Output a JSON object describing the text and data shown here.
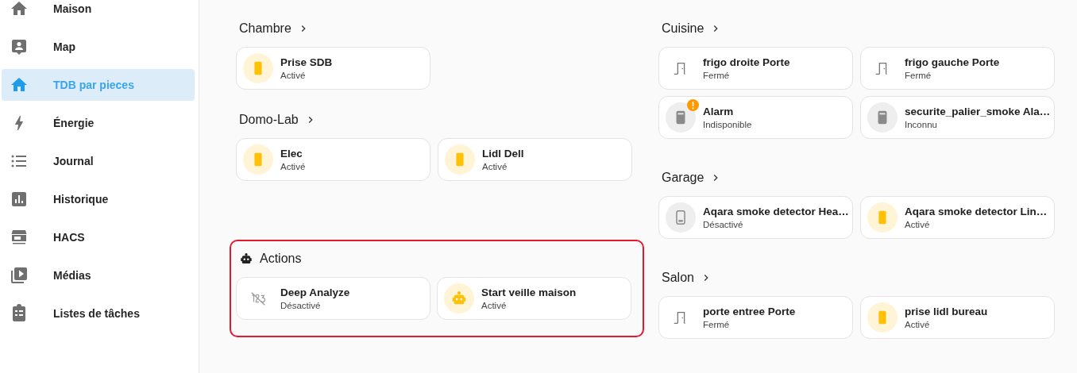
{
  "sidebar": {
    "items": [
      {
        "label": "Maison",
        "kind": "home",
        "selected": false
      },
      {
        "label": "Map",
        "kind": "map",
        "selected": false
      },
      {
        "label": "TDB par pieces",
        "kind": "home",
        "selected": true
      },
      {
        "label": "Énergie",
        "kind": "energy",
        "selected": false
      },
      {
        "label": "Journal",
        "kind": "logbook",
        "selected": false
      },
      {
        "label": "Historique",
        "kind": "history",
        "selected": false
      },
      {
        "label": "HACS",
        "kind": "hacs",
        "selected": false
      },
      {
        "label": "Médias",
        "kind": "media",
        "selected": false
      },
      {
        "label": "Listes de tâches",
        "kind": "todo",
        "selected": false
      }
    ]
  },
  "columns": [
    {
      "sections": [
        {
          "title": "Chambre",
          "kind": "area",
          "cards": [
            {
              "name": "Prise SDB",
              "state": "Activé",
              "kind": "plug",
              "active": true
            }
          ]
        },
        {
          "title": "Domo-Lab",
          "kind": "area",
          "cards": [
            {
              "name": "Elec",
              "state": "Activé",
              "kind": "plug",
              "active": true
            },
            {
              "name": "Lidl Dell",
              "state": "Activé",
              "kind": "plug",
              "active": true
            }
          ]
        },
        {
          "title": "Actions",
          "kind": "automations",
          "cards": [
            {
              "name": "Deep Analyze",
              "state": "Désactivé",
              "kind": "script"
            },
            {
              "name": "Start veille maison",
              "state": "Activé",
              "kind": "robot",
              "active": true
            }
          ]
        }
      ]
    },
    {
      "sections": [
        {
          "title": "Cuisine",
          "kind": "area",
          "cards": [
            {
              "name": "frigo droite Porte",
              "state": "Fermé",
              "kind": "door"
            },
            {
              "name": "frigo gauche Porte",
              "state": "Fermé",
              "kind": "door"
            },
            {
              "name": "Alarm",
              "state": "Indisponible",
              "kind": "detector",
              "active": false,
              "warning": true
            },
            {
              "name": "securite_palier_smoke Ala…",
              "state": "Inconnu",
              "kind": "detector",
              "active": false,
              "warning": false
            }
          ]
        },
        {
          "title": "Garage",
          "kind": "area",
          "cards": [
            {
              "name": "Aqara smoke detector Hea…",
              "state": "Désactivé",
              "kind": "device",
              "active": false
            },
            {
              "name": "Aqara smoke detector Lin…",
              "state": "Activé",
              "kind": "plug",
              "active": true
            }
          ]
        },
        {
          "title": "Salon",
          "kind": "area",
          "cards": [
            {
              "name": "porte entree Porte",
              "state": "Fermé",
              "kind": "door"
            },
            {
              "name": "prise lidl bureau",
              "state": "Activé",
              "kind": "plug",
              "active": true
            }
          ]
        }
      ]
    }
  ]
}
